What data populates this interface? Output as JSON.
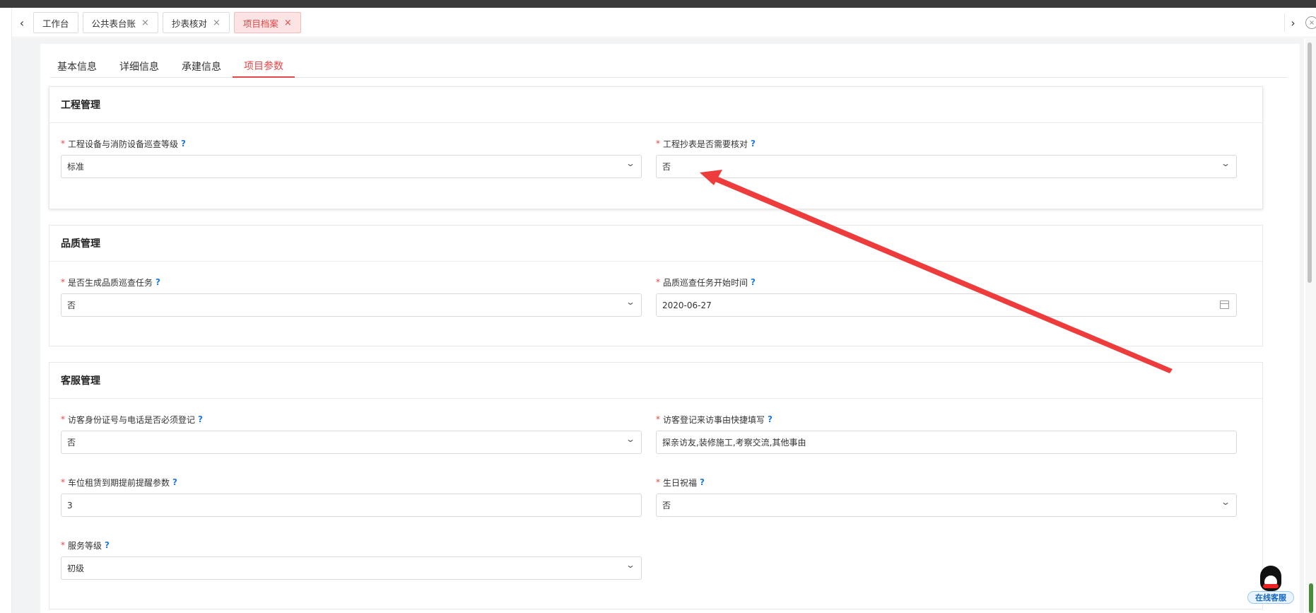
{
  "tabbar": {
    "tabs": [
      {
        "label": "工作台",
        "closable": false
      },
      {
        "label": "公共表台账",
        "closable": true
      },
      {
        "label": "抄表核对",
        "closable": true
      },
      {
        "label": "项目档案",
        "closable": true,
        "active": true
      }
    ],
    "close_glyph": "×"
  },
  "subtabs": [
    "基本信息",
    "详细信息",
    "承建信息",
    "项目参数"
  ],
  "help_mark": "?",
  "required_mark": "*",
  "sections": {
    "engineering": {
      "title": "工程管理",
      "f1": {
        "label": "工程设备与消防设备巡查等级",
        "value": "标准"
      },
      "f2": {
        "label": "工程抄表是否需要核对",
        "value": "否"
      }
    },
    "quality": {
      "title": "品质管理",
      "f1": {
        "label": "是否生成品质巡查任务",
        "value": "否"
      },
      "f2": {
        "label": "品质巡查任务开始时间",
        "value": "2020-06-27"
      }
    },
    "service": {
      "title": "客服管理",
      "f1": {
        "label": "访客身份证号与电话是否必须登记",
        "value": "否"
      },
      "f2": {
        "label": "访客登记来访事由快捷填写",
        "value": "探亲访友,装修施工,考察交流,其他事由"
      },
      "f3": {
        "label": "车位租赁到期提前提醒参数",
        "value": "3"
      },
      "f4": {
        "label": "生日祝福",
        "value": "否"
      },
      "f5": {
        "label": "服务等级",
        "value": "初级"
      }
    }
  },
  "online_service": {
    "label": "在线客服"
  },
  "colors": {
    "accent": "#e64545",
    "annotation_arrow": "#ee3b3b",
    "help": "#1f7ae0"
  }
}
